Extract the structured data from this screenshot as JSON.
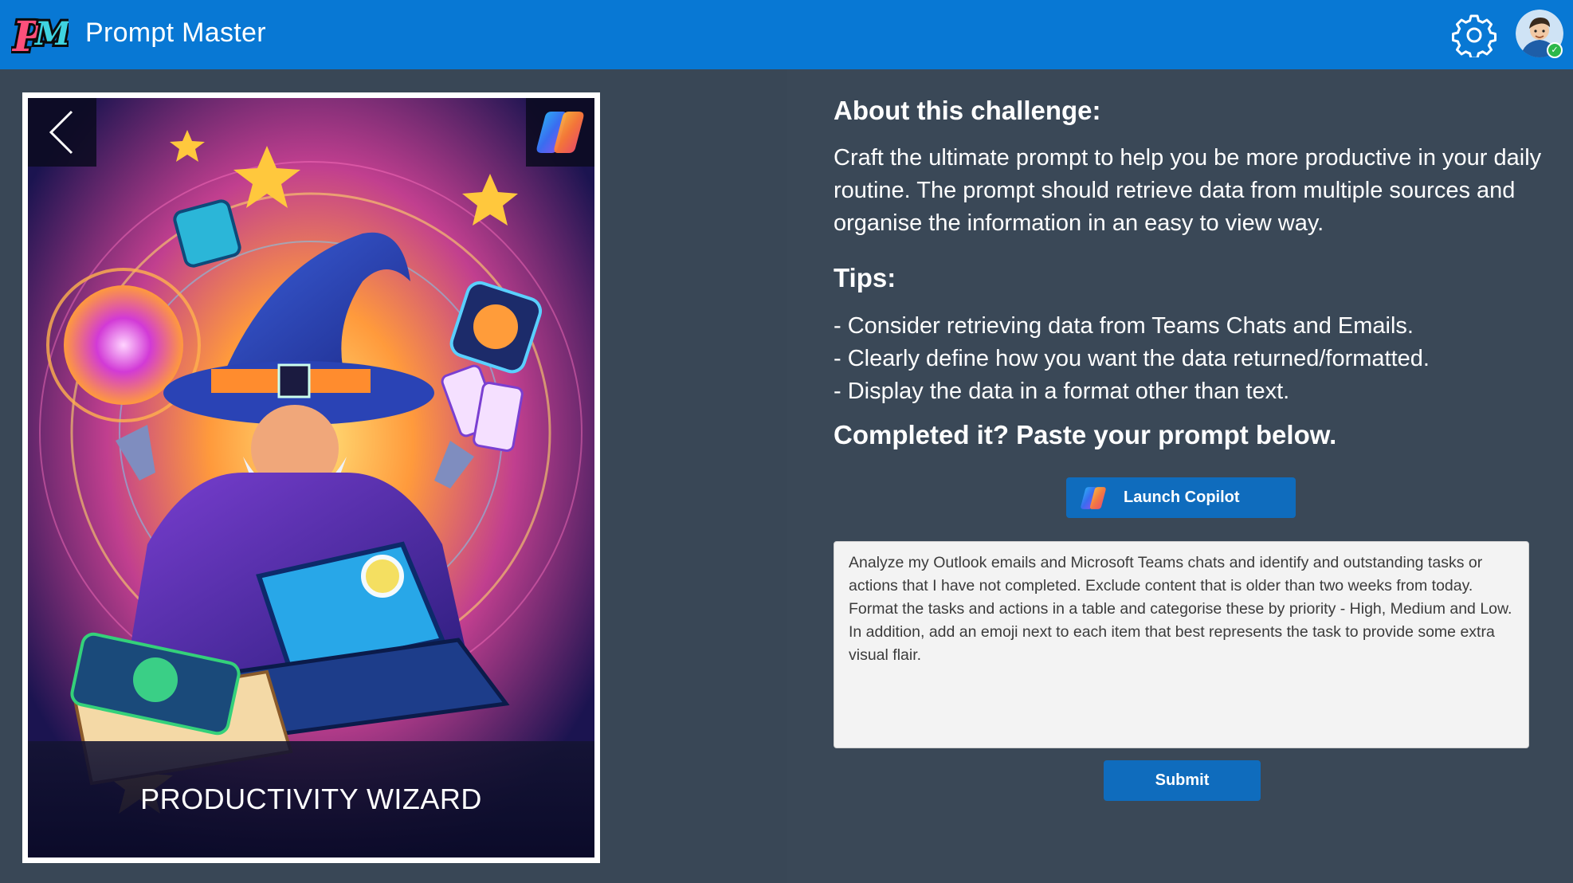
{
  "header": {
    "logo_text": "PM",
    "app_title": "Prompt Master",
    "settings_icon": "gear-icon",
    "avatar_icon": "user-avatar"
  },
  "card": {
    "title": "PRODUCTIVITY WIZARD",
    "back_icon": "chevron-left-icon",
    "badge_icon": "copilot-icon"
  },
  "challenge": {
    "about_heading": "About this challenge:",
    "about_text": "Craft the ultimate prompt to help you be more productive in your daily routine. The prompt should retrieve data from multiple sources and organise the information in an easy to view way.",
    "tips_heading": "Tips:",
    "tips": [
      "- Consider retrieving data from Teams Chats and Emails.",
      "- Clearly define how you want the data returned/formatted.",
      "- Display the data in a format other than text."
    ],
    "completed_heading": "Completed it? Paste your prompt below."
  },
  "actions": {
    "launch_label": "Launch Copilot",
    "submit_label": "Submit"
  },
  "prompt": {
    "value": "Analyze my Outlook emails and Microsoft Teams chats and identify and outstanding tasks or actions that I have not completed. Exclude content that is older than two weeks from today. Format the tasks and actions in a table and categorise these by priority - High, Medium and Low. In addition, add an emoji next to each item that best represents the task to provide some extra visual flair."
  },
  "colors": {
    "header": "#0878d4",
    "background": "#394756",
    "button": "#0f6cbd",
    "status": "#2db84a"
  }
}
